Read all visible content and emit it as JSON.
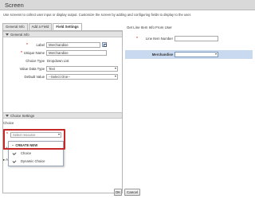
{
  "window": {
    "title": "Screen",
    "description": "Use screens to collect user input or display output. Customize the screen by adding and configuring fields to display to the user."
  },
  "tabs": [
    {
      "label": "General Info"
    },
    {
      "label": "Add a Field"
    },
    {
      "label": "Field Settings",
      "active": true
    }
  ],
  "general_info": {
    "header": "General Info",
    "label": {
      "label": "Label",
      "value": "Merchandise"
    },
    "unique_name": {
      "label": "Unique Name",
      "value": "Merchandise"
    },
    "choice_type": {
      "label": "Choice Type",
      "value": "Dropdown List"
    },
    "value_data_type": {
      "label": "Value Data Type",
      "value": "Text"
    },
    "default_value": {
      "label": "Default Value",
      "value": "--Select One--"
    }
  },
  "choice_settings": {
    "header": "Choice Settings",
    "choice_label": "Choice",
    "select_placeholder": "Select resource",
    "dropdown": {
      "create_new": "CREATE NEW",
      "items": [
        {
          "label": "Choice"
        },
        {
          "label": "Dynamic Choice"
        }
      ]
    },
    "partial_labels": [
      "Add",
      "▸ A"
    ]
  },
  "preview": {
    "title": "Get Line Item Info From User",
    "line_item_number_label": "Line Item Number",
    "merchandise_label": "Merchandise"
  },
  "buttons": {
    "ok": "OK",
    "cancel": "Cancel"
  },
  "colors": {
    "highlight_box": "#c62828",
    "selected_row": "#c9d9ef"
  }
}
